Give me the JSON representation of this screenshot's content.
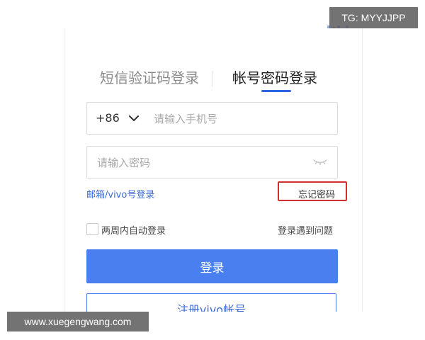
{
  "tabs": {
    "sms_label": "短信验证码登录",
    "password_label": "帐号密码登录",
    "active": "password"
  },
  "phone": {
    "country_code": "+86",
    "placeholder": "请输入手机号"
  },
  "password": {
    "placeholder": "请输入密码"
  },
  "links": {
    "email_login": "邮箱/vivo号登录",
    "forgot_password": "忘记密码",
    "login_problem": "登录遇到问题"
  },
  "remember": {
    "label": "两周内自动登录",
    "checked": false
  },
  "buttons": {
    "login": "登录",
    "register": "注册vivo帐号"
  },
  "watermarks": {
    "top": "TG: MYYJJPP",
    "bottom": "www.xuegengwang.com"
  },
  "icons": {
    "qr": "qr-code-icon",
    "dropdown": "chevron-down-icon",
    "eye": "eye-closed-icon"
  },
  "colors": {
    "accent": "#4a7ff0",
    "link": "#3c6ad8",
    "highlight_box": "#d23030"
  }
}
